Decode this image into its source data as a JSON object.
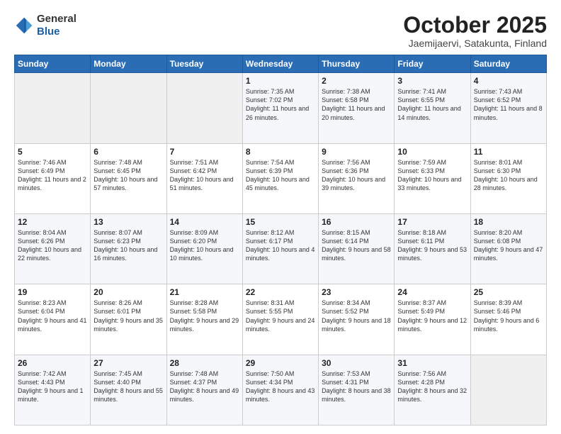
{
  "header": {
    "logo_general": "General",
    "logo_blue": "Blue",
    "month": "October 2025",
    "location": "Jaemijaervi, Satakunta, Finland"
  },
  "weekdays": [
    "Sunday",
    "Monday",
    "Tuesday",
    "Wednesday",
    "Thursday",
    "Friday",
    "Saturday"
  ],
  "weeks": [
    [
      {
        "day": "",
        "sunrise": "",
        "sunset": "",
        "daylight": ""
      },
      {
        "day": "",
        "sunrise": "",
        "sunset": "",
        "daylight": ""
      },
      {
        "day": "",
        "sunrise": "",
        "sunset": "",
        "daylight": ""
      },
      {
        "day": "1",
        "sunrise": "Sunrise: 7:35 AM",
        "sunset": "Sunset: 7:02 PM",
        "daylight": "Daylight: 11 hours and 26 minutes."
      },
      {
        "day": "2",
        "sunrise": "Sunrise: 7:38 AM",
        "sunset": "Sunset: 6:58 PM",
        "daylight": "Daylight: 11 hours and 20 minutes."
      },
      {
        "day": "3",
        "sunrise": "Sunrise: 7:41 AM",
        "sunset": "Sunset: 6:55 PM",
        "daylight": "Daylight: 11 hours and 14 minutes."
      },
      {
        "day": "4",
        "sunrise": "Sunrise: 7:43 AM",
        "sunset": "Sunset: 6:52 PM",
        "daylight": "Daylight: 11 hours and 8 minutes."
      }
    ],
    [
      {
        "day": "5",
        "sunrise": "Sunrise: 7:46 AM",
        "sunset": "Sunset: 6:49 PM",
        "daylight": "Daylight: 11 hours and 2 minutes."
      },
      {
        "day": "6",
        "sunrise": "Sunrise: 7:48 AM",
        "sunset": "Sunset: 6:45 PM",
        "daylight": "Daylight: 10 hours and 57 minutes."
      },
      {
        "day": "7",
        "sunrise": "Sunrise: 7:51 AM",
        "sunset": "Sunset: 6:42 PM",
        "daylight": "Daylight: 10 hours and 51 minutes."
      },
      {
        "day": "8",
        "sunrise": "Sunrise: 7:54 AM",
        "sunset": "Sunset: 6:39 PM",
        "daylight": "Daylight: 10 hours and 45 minutes."
      },
      {
        "day": "9",
        "sunrise": "Sunrise: 7:56 AM",
        "sunset": "Sunset: 6:36 PM",
        "daylight": "Daylight: 10 hours and 39 minutes."
      },
      {
        "day": "10",
        "sunrise": "Sunrise: 7:59 AM",
        "sunset": "Sunset: 6:33 PM",
        "daylight": "Daylight: 10 hours and 33 minutes."
      },
      {
        "day": "11",
        "sunrise": "Sunrise: 8:01 AM",
        "sunset": "Sunset: 6:30 PM",
        "daylight": "Daylight: 10 hours and 28 minutes."
      }
    ],
    [
      {
        "day": "12",
        "sunrise": "Sunrise: 8:04 AM",
        "sunset": "Sunset: 6:26 PM",
        "daylight": "Daylight: 10 hours and 22 minutes."
      },
      {
        "day": "13",
        "sunrise": "Sunrise: 8:07 AM",
        "sunset": "Sunset: 6:23 PM",
        "daylight": "Daylight: 10 hours and 16 minutes."
      },
      {
        "day": "14",
        "sunrise": "Sunrise: 8:09 AM",
        "sunset": "Sunset: 6:20 PM",
        "daylight": "Daylight: 10 hours and 10 minutes."
      },
      {
        "day": "15",
        "sunrise": "Sunrise: 8:12 AM",
        "sunset": "Sunset: 6:17 PM",
        "daylight": "Daylight: 10 hours and 4 minutes."
      },
      {
        "day": "16",
        "sunrise": "Sunrise: 8:15 AM",
        "sunset": "Sunset: 6:14 PM",
        "daylight": "Daylight: 9 hours and 58 minutes."
      },
      {
        "day": "17",
        "sunrise": "Sunrise: 8:18 AM",
        "sunset": "Sunset: 6:11 PM",
        "daylight": "Daylight: 9 hours and 53 minutes."
      },
      {
        "day": "18",
        "sunrise": "Sunrise: 8:20 AM",
        "sunset": "Sunset: 6:08 PM",
        "daylight": "Daylight: 9 hours and 47 minutes."
      }
    ],
    [
      {
        "day": "19",
        "sunrise": "Sunrise: 8:23 AM",
        "sunset": "Sunset: 6:04 PM",
        "daylight": "Daylight: 9 hours and 41 minutes."
      },
      {
        "day": "20",
        "sunrise": "Sunrise: 8:26 AM",
        "sunset": "Sunset: 6:01 PM",
        "daylight": "Daylight: 9 hours and 35 minutes."
      },
      {
        "day": "21",
        "sunrise": "Sunrise: 8:28 AM",
        "sunset": "Sunset: 5:58 PM",
        "daylight": "Daylight: 9 hours and 29 minutes."
      },
      {
        "day": "22",
        "sunrise": "Sunrise: 8:31 AM",
        "sunset": "Sunset: 5:55 PM",
        "daylight": "Daylight: 9 hours and 24 minutes."
      },
      {
        "day": "23",
        "sunrise": "Sunrise: 8:34 AM",
        "sunset": "Sunset: 5:52 PM",
        "daylight": "Daylight: 9 hours and 18 minutes."
      },
      {
        "day": "24",
        "sunrise": "Sunrise: 8:37 AM",
        "sunset": "Sunset: 5:49 PM",
        "daylight": "Daylight: 9 hours and 12 minutes."
      },
      {
        "day": "25",
        "sunrise": "Sunrise: 8:39 AM",
        "sunset": "Sunset: 5:46 PM",
        "daylight": "Daylight: 9 hours and 6 minutes."
      }
    ],
    [
      {
        "day": "26",
        "sunrise": "Sunrise: 7:42 AM",
        "sunset": "Sunset: 4:43 PM",
        "daylight": "Daylight: 9 hours and 1 minute."
      },
      {
        "day": "27",
        "sunrise": "Sunrise: 7:45 AM",
        "sunset": "Sunset: 4:40 PM",
        "daylight": "Daylight: 8 hours and 55 minutes."
      },
      {
        "day": "28",
        "sunrise": "Sunrise: 7:48 AM",
        "sunset": "Sunset: 4:37 PM",
        "daylight": "Daylight: 8 hours and 49 minutes."
      },
      {
        "day": "29",
        "sunrise": "Sunrise: 7:50 AM",
        "sunset": "Sunset: 4:34 PM",
        "daylight": "Daylight: 8 hours and 43 minutes."
      },
      {
        "day": "30",
        "sunrise": "Sunrise: 7:53 AM",
        "sunset": "Sunset: 4:31 PM",
        "daylight": "Daylight: 8 hours and 38 minutes."
      },
      {
        "day": "31",
        "sunrise": "Sunrise: 7:56 AM",
        "sunset": "Sunset: 4:28 PM",
        "daylight": "Daylight: 8 hours and 32 minutes."
      },
      {
        "day": "",
        "sunrise": "",
        "sunset": "",
        "daylight": ""
      }
    ]
  ]
}
